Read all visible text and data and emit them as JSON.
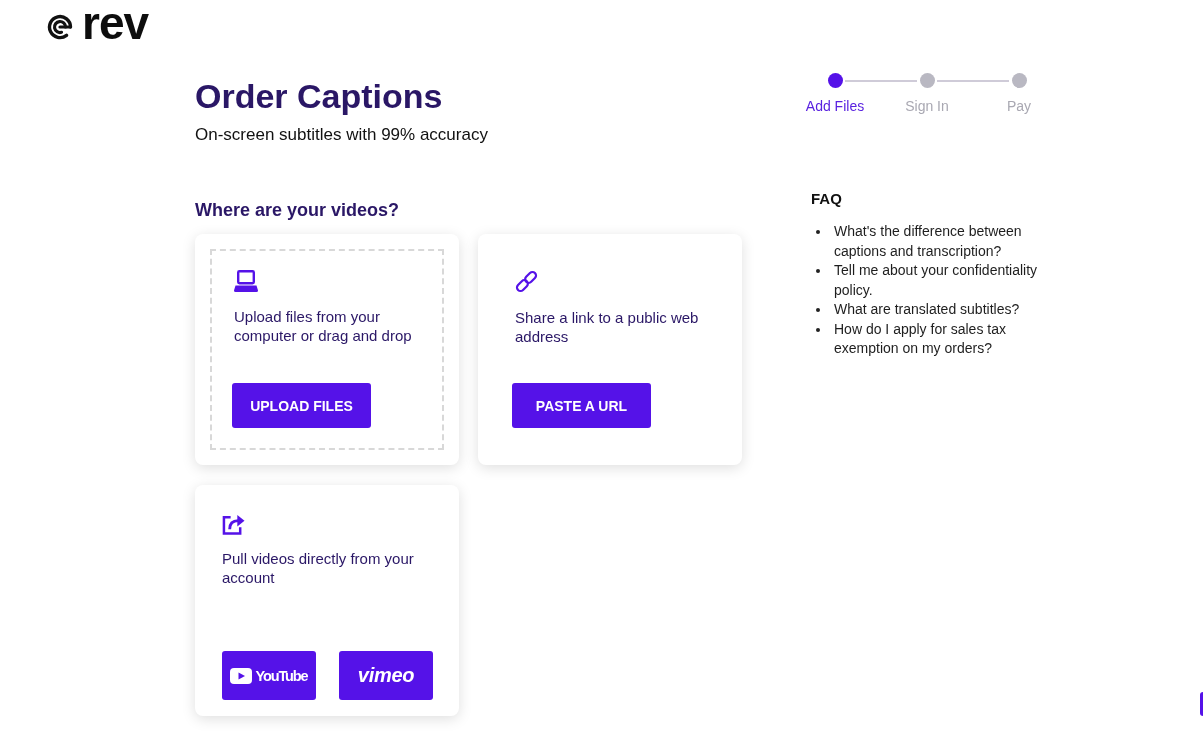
{
  "logo": {
    "text": "rev"
  },
  "header": {
    "title": "Order Captions",
    "subtitle": "On-screen subtitles with 99% accuracy"
  },
  "steps": [
    {
      "label": "Add Files",
      "current": true
    },
    {
      "label": "Sign In",
      "current": false
    },
    {
      "label": "Pay",
      "current": false
    }
  ],
  "section_title": "Where are your videos?",
  "options": [
    {
      "kind": "upload",
      "text": "Upload files from your computer or drag and drop",
      "buttons": [
        {
          "kind": "text",
          "label": "UPLOAD FILES"
        }
      ]
    },
    {
      "kind": "link",
      "text": "Share a link to a public web address",
      "buttons": [
        {
          "kind": "text",
          "label": "PASTE A URL"
        }
      ]
    },
    {
      "kind": "account",
      "text": "Pull videos directly from your account",
      "buttons": [
        {
          "kind": "youtube",
          "label": "YouTube"
        },
        {
          "kind": "vimeo",
          "label": "vimeo"
        }
      ]
    }
  ],
  "faq": {
    "title": "FAQ",
    "items": [
      "What's the difference between captions and transcription?",
      "Tell me about your confidentiality policy.",
      "What are translated subtitles?",
      "How do I apply for sales tax exemption on my orders?"
    ]
  }
}
